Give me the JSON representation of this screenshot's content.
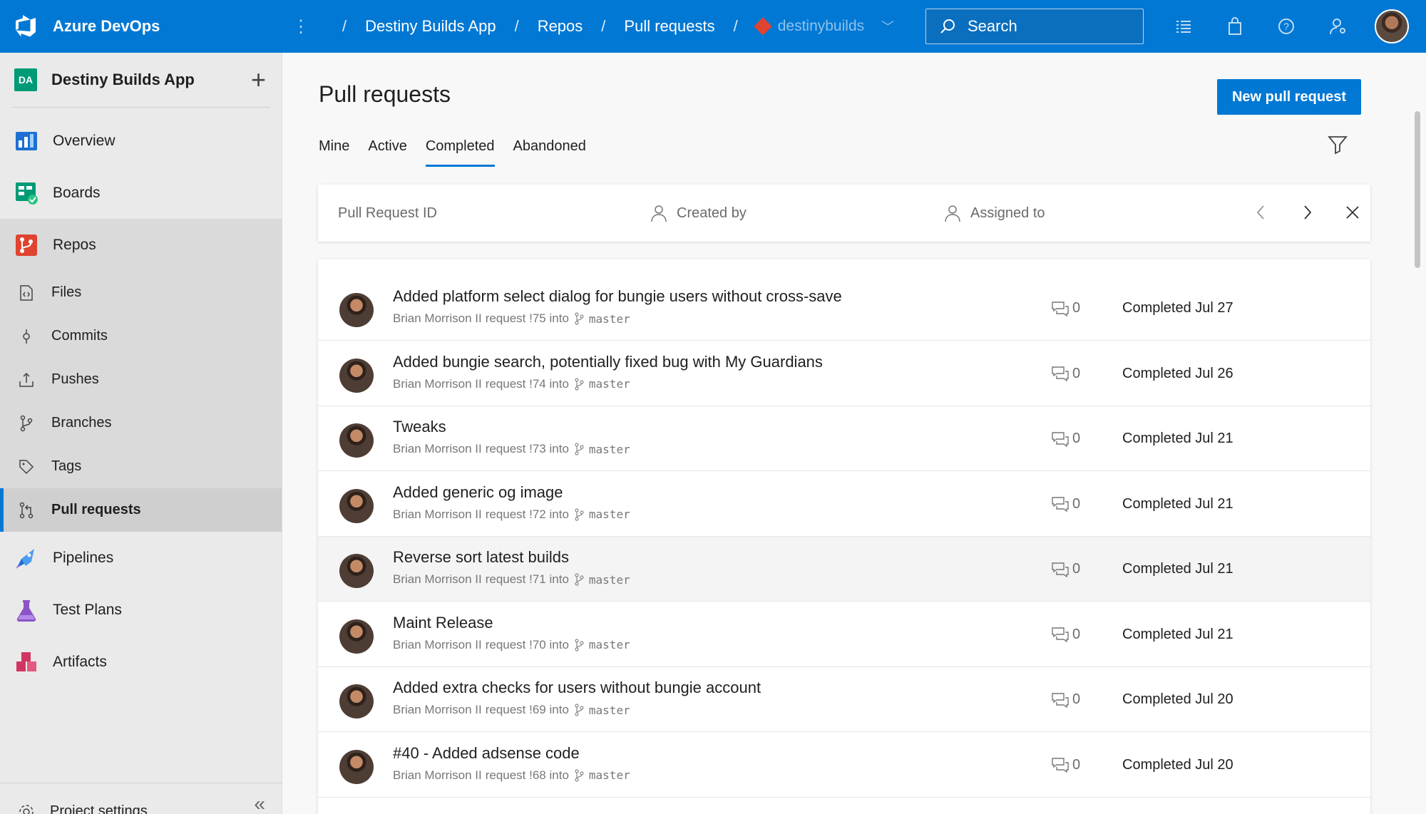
{
  "app": {
    "name": "Azure DevOps"
  },
  "breadcrumb": {
    "project": "Destiny Builds App",
    "section": "Repos",
    "page": "Pull requests",
    "repo": "destinybuilds"
  },
  "search": {
    "placeholder": "Search"
  },
  "sidebar": {
    "project_initials": "DA",
    "project_name": "Destiny Builds App",
    "items": [
      {
        "label": "Overview"
      },
      {
        "label": "Boards"
      },
      {
        "label": "Repos"
      }
    ],
    "repo_items": [
      {
        "label": "Files"
      },
      {
        "label": "Commits"
      },
      {
        "label": "Pushes"
      },
      {
        "label": "Branches"
      },
      {
        "label": "Tags"
      },
      {
        "label": "Pull requests"
      }
    ],
    "bottom_items": [
      {
        "label": "Pipelines"
      },
      {
        "label": "Test Plans"
      },
      {
        "label": "Artifacts"
      }
    ],
    "footer_label": "Project settings"
  },
  "main": {
    "title": "Pull requests",
    "new_button": "New pull request",
    "tabs": [
      "Mine",
      "Active",
      "Completed",
      "Abandoned"
    ],
    "active_tab": "Completed",
    "filters": {
      "pr_id": "Pull Request ID",
      "created_by": "Created by",
      "assigned_to": "Assigned to"
    }
  },
  "pull_requests": [
    {
      "title": "Added platform select dialog for bungie users without cross-save",
      "author": "Brian Morrison II",
      "request_text": "request !75 into",
      "branch": "master",
      "comments": "0",
      "status": "Completed Jul 27"
    },
    {
      "title": "Added bungie search, potentially fixed bug with My Guardians",
      "author": "Brian Morrison II",
      "request_text": "request !74 into",
      "branch": "master",
      "comments": "0",
      "status": "Completed Jul 26"
    },
    {
      "title": "Tweaks",
      "author": "Brian Morrison II",
      "request_text": "request !73 into",
      "branch": "master",
      "comments": "0",
      "status": "Completed Jul 21"
    },
    {
      "title": "Added generic og image",
      "author": "Brian Morrison II",
      "request_text": "request !72 into",
      "branch": "master",
      "comments": "0",
      "status": "Completed Jul 21"
    },
    {
      "title": "Reverse sort latest builds",
      "author": "Brian Morrison II",
      "request_text": "request !71 into",
      "branch": "master",
      "comments": "0",
      "status": "Completed Jul 21"
    },
    {
      "title": "Maint Release",
      "author": "Brian Morrison II",
      "request_text": "request !70 into",
      "branch": "master",
      "comments": "0",
      "status": "Completed Jul 21"
    },
    {
      "title": "Added extra checks for users without bungie account",
      "author": "Brian Morrison II",
      "request_text": "request !69 into",
      "branch": "master",
      "comments": "0",
      "status": "Completed Jul 20"
    },
    {
      "title": "#40 - Added adsense code",
      "author": "Brian Morrison II",
      "request_text": "request !68 into",
      "branch": "master",
      "comments": "0",
      "status": "Completed Jul 20"
    }
  ],
  "colors": {
    "accent": "#0078d4",
    "repo_icon": "#e0432f",
    "project_badge": "#009b76"
  }
}
